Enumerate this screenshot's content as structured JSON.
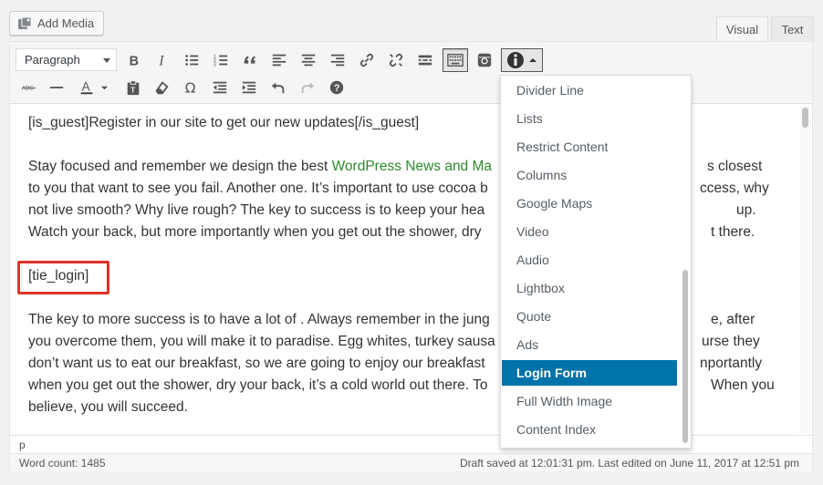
{
  "media": {
    "add_label": "Add Media"
  },
  "tabs": {
    "visual": "Visual",
    "text": "Text"
  },
  "toolbar": {
    "format": "Paragraph"
  },
  "content": {
    "p1": "[is_guest]Register in our site to get our new updates[/is_guest]",
    "p2_a": "Stay focused and remember we design the best ",
    "p2_link": "WordPress News and Ma",
    "p2_b": "s closest",
    "p2_c": "to you that want to see you fail. Another one. It’s important to use cocoa b",
    "p2_d": "ccess, why",
    "p2_e": "not live smooth? Why live rough? The key to success is to keep your hea",
    "p2_f": "up.",
    "p2_g": "Watch your back, but more importantly when you get out the shower, dry",
    "p2_h": "t there.",
    "shortcode": "[tie_login]",
    "p4_a": "The key to more success is to have a lot of . Always remember in the jung",
    "p4_b": "e, after",
    "p4_c": "you overcome them, you will make it to paradise. Egg whites, turkey sausa",
    "p4_d": "urse they",
    "p4_e": "don’t want us to eat our breakfast, so we are going to enjoy our breakfast",
    "p4_f": "nportantly",
    "p4_g": "when you get out the shower, dry your back, it’s a cold world out there. To",
    "p4_h": "When you",
    "p4_i": "believe, you will succeed."
  },
  "status": {
    "path": "p",
    "word_count": "Word count: 1485",
    "saved": "Draft saved at 12:01:31 pm. Last edited on June 11, 2017 at 12:51 pm"
  },
  "dropdown": {
    "items": [
      "Divider Line",
      "Lists",
      "Restrict Content",
      "Columns",
      "Google Maps",
      "Video",
      "Audio",
      "Lightbox",
      "Quote",
      "Ads",
      "Login Form",
      "Full Width Image",
      "Content Index"
    ],
    "selected": "Login Form"
  },
  "colors": {
    "accent": "#0073aa",
    "highlight_box": "#e0342a",
    "link_green": "#2c8a2c"
  }
}
